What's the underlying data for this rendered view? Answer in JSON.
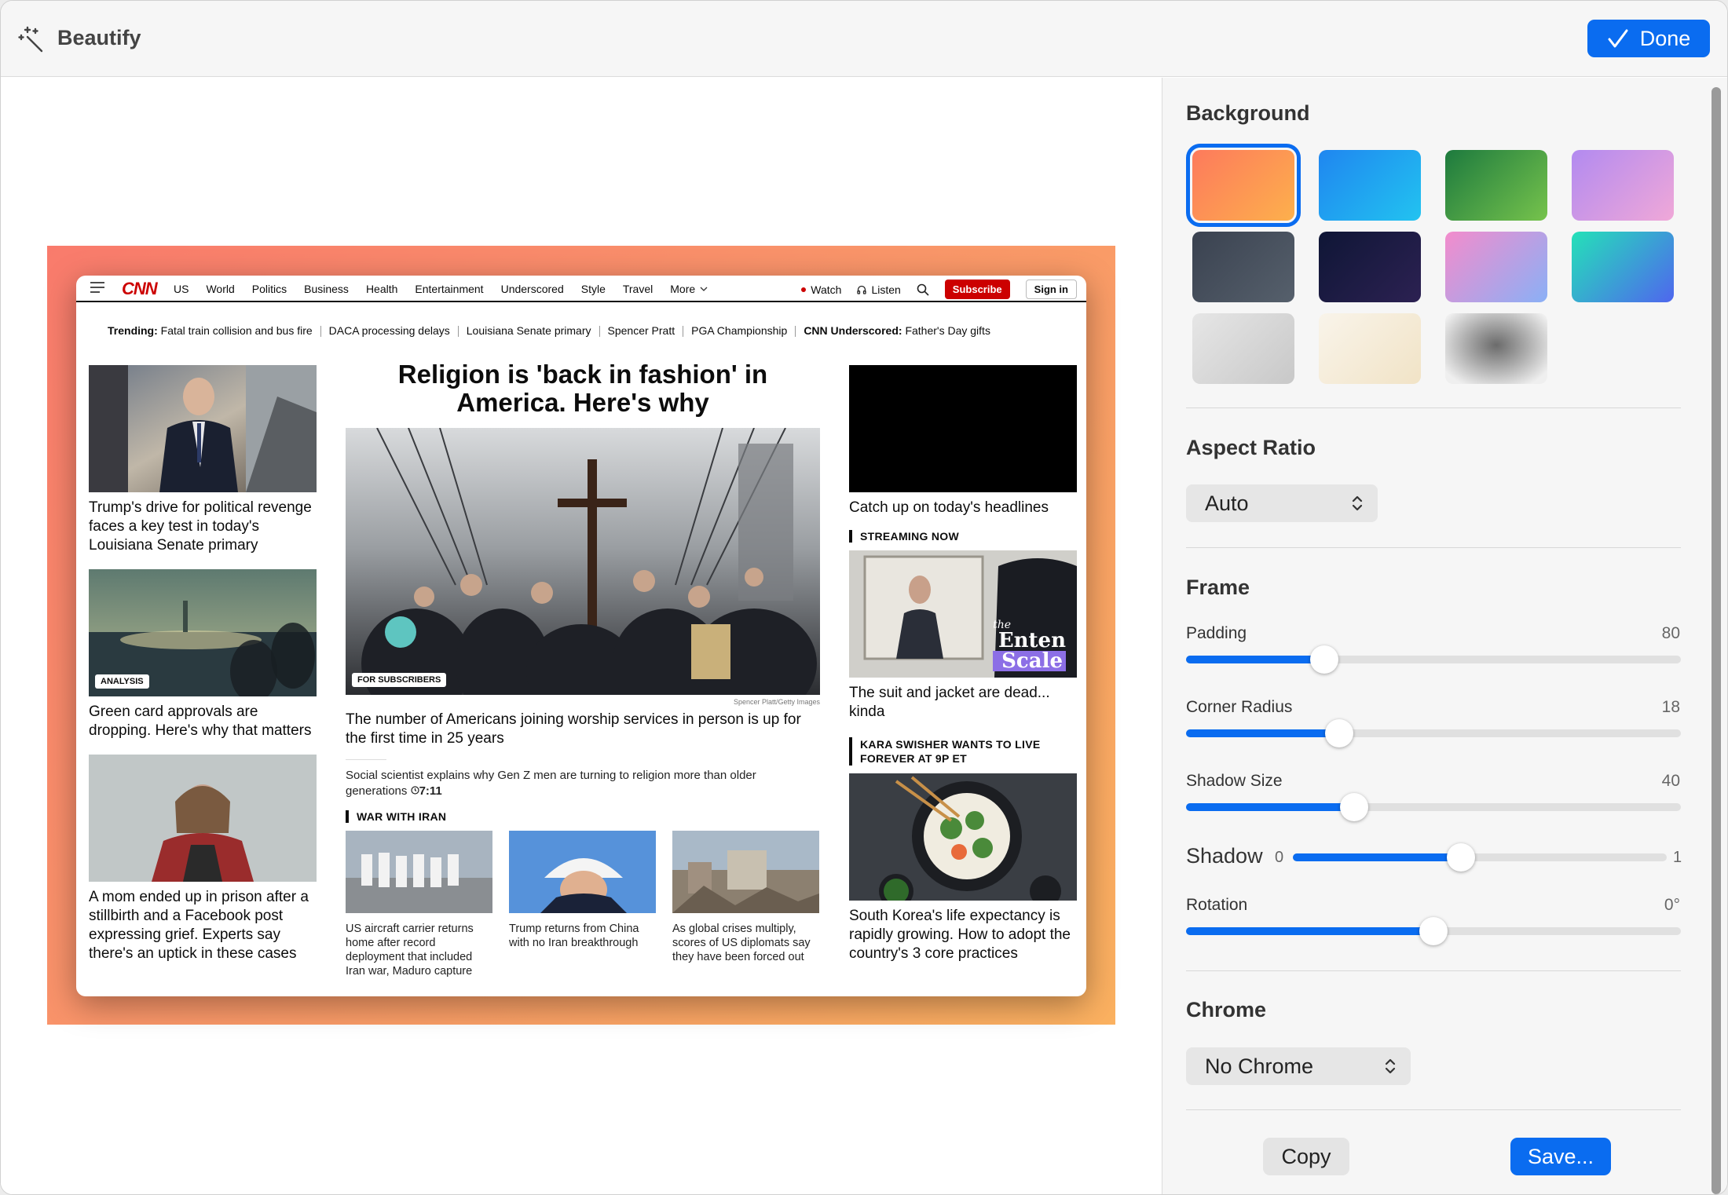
{
  "app": {
    "title": "Beautify",
    "done_label": "Done"
  },
  "preview": {
    "nav": {
      "logo": "CNN",
      "links": [
        "US",
        "World",
        "Politics",
        "Business",
        "Health",
        "Entertainment",
        "Underscored",
        "Style",
        "Travel"
      ],
      "more": "More",
      "watch": "Watch",
      "listen": "Listen",
      "subscribe": "Subscribe",
      "signin": "Sign in"
    },
    "trending": {
      "label": "Trending:",
      "items": [
        "Fatal train collision and bus fire",
        "DACA processing delays",
        "Louisiana Senate primary",
        "Spencer Pratt",
        "PGA Championship"
      ],
      "underscored_label": "CNN Underscored:",
      "underscored_item": "Father's Day gifts"
    },
    "left_stories": [
      {
        "headline": "Trump's drive for political revenge faces a key test in today's Louisiana Senate primary",
        "badge": ""
      },
      {
        "headline": "Green card approvals are dropping. Here's why that matters",
        "badge": "ANALYSIS"
      },
      {
        "headline": "A mom ended up in prison after a stillbirth and a Facebook post expressing grief. Experts say there's an uptick in these cases",
        "badge": ""
      }
    ],
    "main": {
      "headline": "Religion is 'back in fashion' in America. Here's why",
      "badge": "FOR SUBSCRIBERS",
      "credit": "Spencer Platt/Getty Images",
      "sub": "The number of Americans joining worship services in person is up for the first time in 25 years",
      "sci": "Social scientist explains why Gen Z men are turning to religion more than older generations",
      "sci_duration": "7:11",
      "section": "WAR WITH IRAN",
      "iran": [
        "US aircraft carrier returns home after record deployment that included Iran war, Maduro capture",
        "Trump returns from China with no Iran breakthrough",
        "As global crises multiply, scores of US diplomats say they have been forced out"
      ]
    },
    "right": {
      "video_caption": "Catch up on today's headlines",
      "streaming_label": "STREAMING NOW",
      "streaming_headline": "The suit and jacket are dead... kinda",
      "overlay_the": "the",
      "overlay_enten": "Enten",
      "overlay_scale": "Scale",
      "kara_label": "KARA SWISHER WANTS TO LIVE FOREVER AT 9P ET",
      "kara_headline": "South Korea's life expectancy is rapidly growing. How to adopt the country's 3 core practices"
    }
  },
  "panel": {
    "background_title": "Background",
    "swatches": [
      {
        "name": "coral-orange",
        "from": "#fd7a5c",
        "to": "#fdb04c",
        "selected": true
      },
      {
        "name": "blue",
        "from": "#1f86f0",
        "to": "#22c3f0",
        "selected": false
      },
      {
        "name": "green",
        "from": "#1d7a3e",
        "to": "#76c34c",
        "selected": false
      },
      {
        "name": "purple-pink",
        "from": "#b28af0",
        "to": "#f0a8d8",
        "selected": false
      },
      {
        "name": "slate",
        "from": "#3a4250",
        "to": "#56606c",
        "selected": false
      },
      {
        "name": "navy",
        "from": "#0f1636",
        "to": "#2c2152",
        "selected": false
      },
      {
        "name": "pink-blue",
        "from": "#f38ccc",
        "to": "#8ab0f6",
        "selected": false
      },
      {
        "name": "teal-blue",
        "from": "#24e1b8",
        "to": "#4f66ee",
        "selected": false
      },
      {
        "name": "light-gray",
        "from": "#e6e6e6",
        "to": "#c8c8c8",
        "selected": false
      },
      {
        "name": "cream",
        "from": "#f9f4ea",
        "to": "#f1e3c6",
        "selected": false
      },
      {
        "name": "blurred",
        "from": "#efefef",
        "to": "#6b6b6b",
        "selected": false
      }
    ],
    "aspect_title": "Aspect Ratio",
    "aspect_value": "Auto",
    "frame_title": "Frame",
    "padding": {
      "label": "Padding",
      "value": "80",
      "level": 0.28
    },
    "corner": {
      "label": "Corner Radius",
      "value": "18",
      "level": 0.31
    },
    "shadow_size": {
      "label": "Shadow Size",
      "value": "40",
      "level": 0.34
    },
    "shadow": {
      "label": "Shadow",
      "min": "0",
      "max": "1",
      "level": 0.45
    },
    "rotation": {
      "label": "Rotation",
      "value": "0°",
      "level": 0.5
    },
    "chrome_title": "Chrome",
    "chrome_value": "No Chrome",
    "copy_label": "Copy",
    "save_label": "Save..."
  },
  "colors": {
    "accent": "#0a6cf0",
    "cnn_red": "#cc0000"
  }
}
